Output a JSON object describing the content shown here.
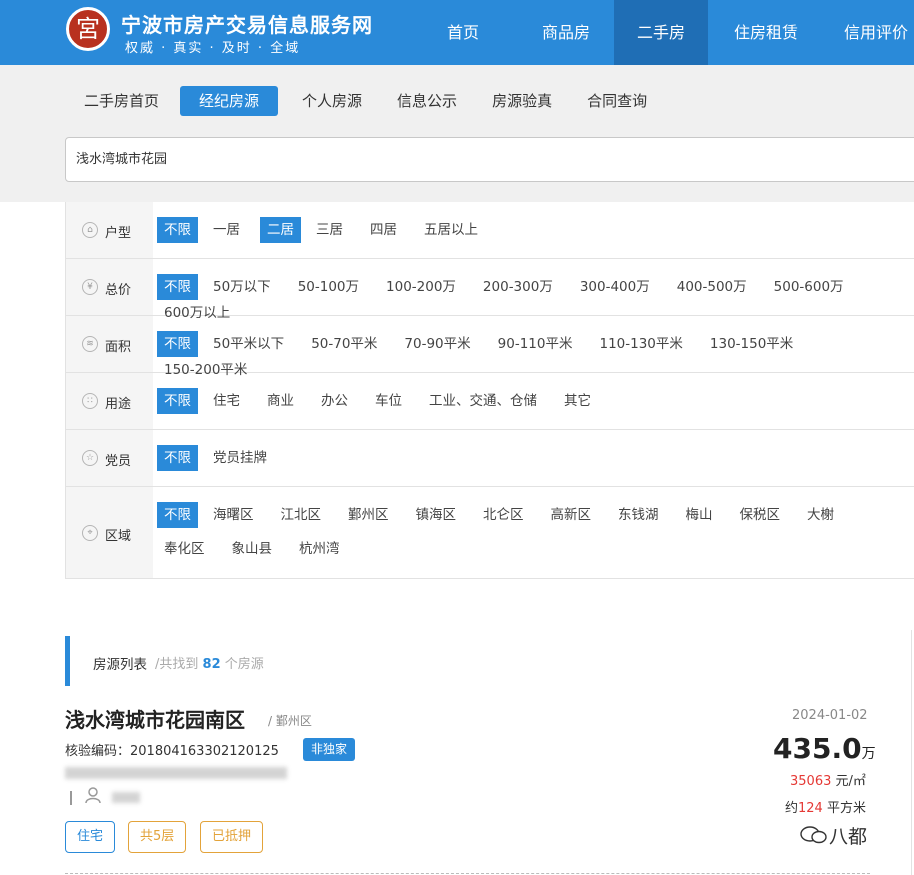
{
  "header": {
    "logo_char": "宮",
    "site_title": "宁波市房产交易信息服务网",
    "slogan": "权威 · 真实 · 及时 · 全域",
    "nav": [
      "首页",
      "商品房",
      "二手房",
      "住房租赁",
      "信用评价"
    ],
    "nav_active": "二手房"
  },
  "subnav": {
    "items": [
      "二手房首页",
      "经纪房源",
      "个人房源",
      "信息公示",
      "房源验真",
      "合同查询"
    ],
    "active": "经纪房源"
  },
  "search": {
    "value": "浅水湾城市花园"
  },
  "filters": {
    "layout": {
      "label": "户型",
      "options": [
        "不限",
        "一居",
        "二居",
        "三居",
        "四居",
        "五居以上"
      ],
      "selected": "二居"
    },
    "price": {
      "label": "总价",
      "options": [
        "不限",
        "50万以下",
        "50-100万",
        "100-200万",
        "200-300万",
        "300-400万",
        "400-500万",
        "500-600万",
        "600万以上"
      ],
      "selected": "不限"
    },
    "area": {
      "label": "面积",
      "options": [
        "不限",
        "50平米以下",
        "50-70平米",
        "70-90平米",
        "90-110平米",
        "110-130平米",
        "130-150平米",
        "150-200平米"
      ],
      "selected": "不限"
    },
    "usage": {
      "label": "用途",
      "options": [
        "不限",
        "住宅",
        "商业",
        "办公",
        "车位",
        "工业、交通、仓储",
        "其它"
      ],
      "selected": "不限"
    },
    "party": {
      "label": "党员",
      "options": [
        "不限",
        "党员挂牌"
      ],
      "selected": "不限"
    },
    "district": {
      "label": "区域",
      "options": [
        "不限",
        "海曙区",
        "江北区",
        "鄞州区",
        "镇海区",
        "北仑区",
        "高新区",
        "东钱湖",
        "梅山",
        "保税区",
        "大榭",
        "奉化区",
        "象山县",
        "杭州湾"
      ],
      "selected": "不限"
    }
  },
  "listing_header": {
    "title": "房源列表",
    "count_prefix": "/共找到",
    "count": "82",
    "count_suffix": "个房源"
  },
  "listing": {
    "title": "浅水湾城市花园南区",
    "district": "/ 鄞州区",
    "code": "核验编码：201804163302120125",
    "badge": "非独家",
    "tags": [
      "住宅",
      "共5层",
      "已抵押"
    ],
    "date": "2024-01-02",
    "price": "435.0",
    "price_unit": "万",
    "unit_price": "35063",
    "unit_price_unit": "元/㎡",
    "area_prefix": "约",
    "area": "124",
    "area_unit": "平方米"
  },
  "watermark": "八都",
  "colors": {
    "primary": "#2a8ad9",
    "nav_active": "#1f6eb5",
    "tag_orange": "#e3a33a",
    "price_red": "#e53935"
  }
}
